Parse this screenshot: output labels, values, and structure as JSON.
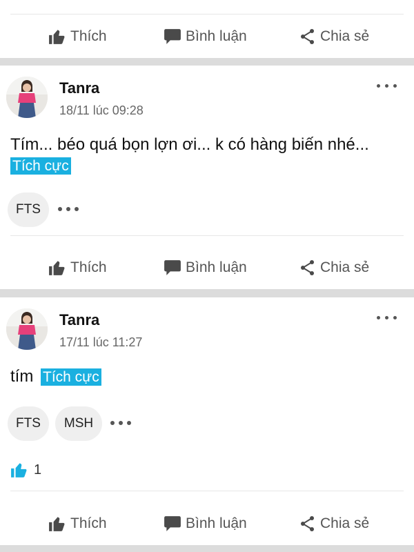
{
  "actions": {
    "like": "Thích",
    "comment": "Bình luận",
    "share": "Chia sẻ"
  },
  "posts": [
    {
      "author": "Tanra",
      "time": "18/11 lúc 09:28",
      "text": "Tím... béo quá bọn lợn ơi... k có hàng biến nhé...",
      "tag": "Tích cực",
      "chips": [
        "FTS"
      ]
    },
    {
      "author": "Tanra",
      "time": "17/11 lúc 11:27",
      "text": "tím",
      "tag": "Tích cực",
      "chips": [
        "FTS",
        "MSH"
      ],
      "likes": "1"
    }
  ],
  "colors": {
    "accent": "#1ab0e0",
    "background": "#dcdcdc"
  }
}
